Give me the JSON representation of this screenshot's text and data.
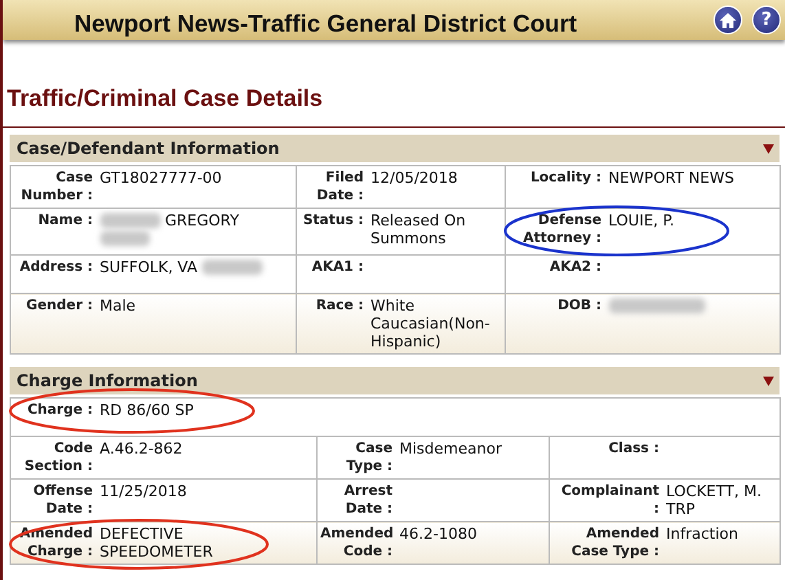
{
  "header": {
    "title": "Newport News-Traffic General District Court",
    "icons": [
      {
        "kind": "home"
      },
      {
        "kind": "help",
        "glyph": "?"
      }
    ]
  },
  "page_title": "Traffic/Criminal Case Details",
  "sections": [
    {
      "title": "Case/Defendant Information",
      "expanded": true,
      "rows": [
        [
          {
            "label": "Case Number :",
            "value": "GT18027777-00"
          },
          {
            "label": "Filed Date :",
            "value": "12/05/2018"
          },
          {
            "label": "Locality :",
            "value": "NEWPORT NEWS"
          }
        ],
        [
          {
            "label": "Name :",
            "value": "GREGORY",
            "redacted_before": true,
            "redacted_after": true
          },
          {
            "label": "Status :",
            "value": "Released On Summons"
          },
          {
            "label": "Defense Attorney :",
            "value": "LOUIE, P.",
            "color": "#1a33cc"
          }
        ],
        [
          {
            "label": "Address :",
            "value": "SUFFOLK, VA",
            "redacted_after": true
          },
          {
            "label": "AKA1 :"
          },
          {
            "label": "AKA2 :"
          }
        ],
        [
          {
            "label": "Gender :",
            "value": "Male"
          },
          {
            "label": "Race :",
            "value": "White Caucasian(Non-Hispanic)"
          },
          {
            "label": "DOB :",
            "redacted_after": true
          }
        ]
      ]
    },
    {
      "title": "Charge Information",
      "expanded": true,
      "rows": [
        [
          {
            "label": "Charge :",
            "value": "RD 86/60 SP",
            "color": "#e0321e"
          }
        ],
        [
          {
            "label": "Code Section :",
            "value": "A.46.2-862"
          },
          {
            "label": "Case Type :",
            "value": "Misdemeanor"
          },
          {
            "label": "Class :"
          }
        ],
        [
          {
            "label": "Offense Date :",
            "value": "11/25/2018"
          },
          {
            "label": "Arrest Date :"
          },
          {
            "label": "Complainant :",
            "value": "LOCKETT, M. TRP"
          }
        ],
        [
          {
            "label": "Amended Charge :",
            "value": "DEFECTIVE SPEEDOMETER",
            "color": "#e0321e"
          },
          {
            "label": "Amended Code :",
            "value": "46.2-1080"
          },
          {
            "label": "Amended Case Type :",
            "value": "Infraction"
          }
        ]
      ]
    }
  ]
}
